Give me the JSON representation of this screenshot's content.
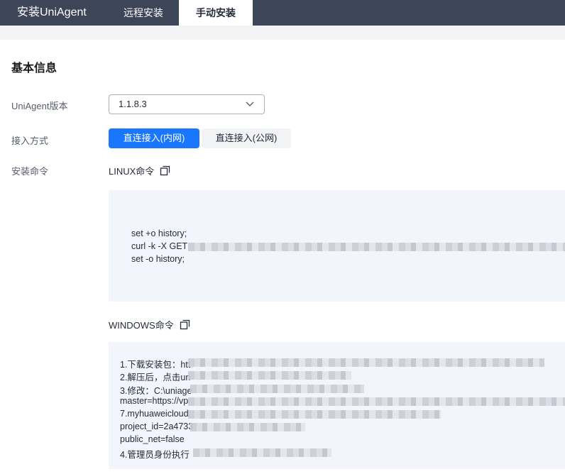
{
  "header": {
    "app_title": "安装UniAgent",
    "tabs": [
      "远程安装",
      "手动安装"
    ],
    "active_tab": "手动安装"
  },
  "basic_info": {
    "title": "基本信息",
    "version_label": "UniAgent版本",
    "version_value": "1.1.8.3",
    "access_label": "接入方式",
    "access_options": [
      "直连接入(内网)",
      "直连接入(公网)"
    ],
    "access_selected": "直连接入(内网)",
    "install_cmd_label": "安装命令"
  },
  "linux": {
    "label": "LINUX命令",
    "lines": [
      "set +o history;",
      "curl -k -X GET",
      "set -o history;"
    ]
  },
  "windows": {
    "label": "WINDOWS命令",
    "lines": [
      "1.下载安装包：htt",
      "2.解压后，点击un",
      "3.修改：C:\\uniage",
      "master=https://vp",
      "7.myhuaweicloud.",
      "project_id=2a4733",
      "public_net=false",
      "4.管理员身份执行"
    ]
  },
  "colors": {
    "header_bg": "#3d4559",
    "accent": "#1876ff",
    "code_bg": "#f2f5fc"
  },
  "icons": {
    "copy": "copy-icon",
    "dropdown": "chevron-down-icon"
  }
}
